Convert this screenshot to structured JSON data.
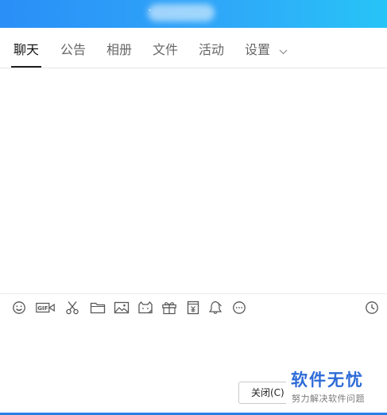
{
  "titlebar": {
    "title_fragment": "-",
    "accent_colors": [
      "#2a8ff7",
      "#27c4f7"
    ]
  },
  "tabs": [
    {
      "label": "聊天",
      "active": true
    },
    {
      "label": "公告",
      "active": false
    },
    {
      "label": "相册",
      "active": false
    },
    {
      "label": "文件",
      "active": false
    },
    {
      "label": "活动",
      "active": false
    },
    {
      "label": "设置",
      "active": false,
      "has_dropdown": true
    }
  ],
  "toolbar": {
    "icons": [
      "smiley-icon",
      "gif-icon",
      "scissors-icon",
      "folder-icon",
      "image-icon",
      "sticker-icon",
      "gift-icon",
      "red-packet-icon",
      "bell-icon",
      "more-icon",
      "history-clock-icon"
    ],
    "gif_text": "GIF"
  },
  "footer": {
    "close_label": "关闭(C)"
  },
  "watermark": {
    "title": "软件无忧",
    "subtitle": "努力解决软件问题",
    "color": "#2e6bd8"
  }
}
